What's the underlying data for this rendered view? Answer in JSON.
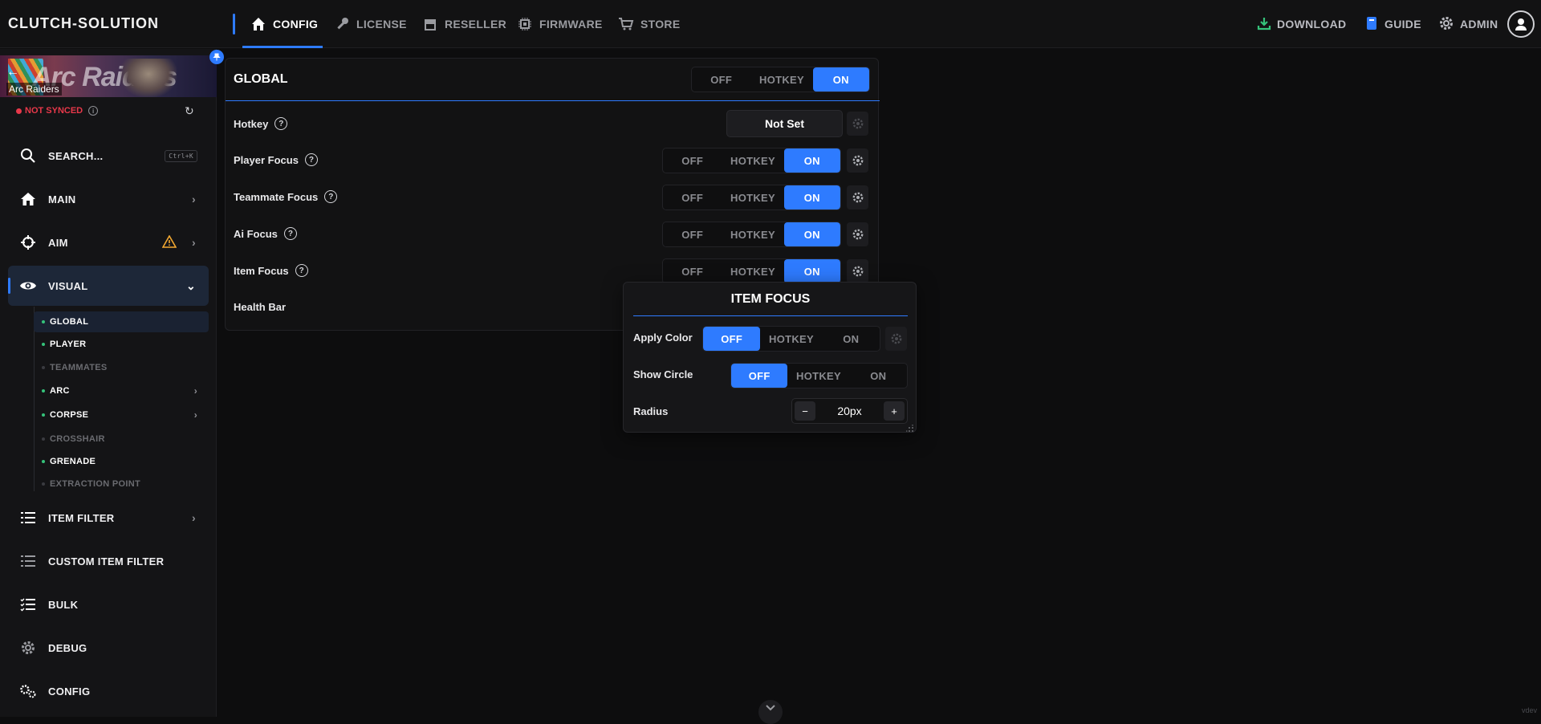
{
  "app": {
    "brand": "CLUTCH-SOLUTION",
    "accent": "#2e7bff",
    "version_tag": "vdev"
  },
  "nav": {
    "tabs": [
      {
        "label": "CONFIG",
        "icon": "home-icon",
        "active": true
      },
      {
        "label": "LICENSE",
        "icon": "key-icon"
      },
      {
        "label": "RESELLER",
        "icon": "store-icon"
      },
      {
        "label": "FIRMWARE",
        "icon": "chip-icon"
      },
      {
        "label": "STORE",
        "icon": "cart-icon"
      }
    ],
    "right": {
      "download": "DOWNLOAD",
      "guide": "GUIDE",
      "admin": "ADMIN"
    }
  },
  "sidebar": {
    "game_name": "Arc Raiders",
    "banner_text": "Arc Raiders",
    "sync_status": "NOT SYNCED",
    "search_label": "SEARCH...",
    "search_shortcut": "Ctrl+K",
    "items": [
      {
        "label": "MAIN",
        "icon": "home-icon"
      },
      {
        "label": "AIM",
        "icon": "crosshair-icon",
        "warning": true
      },
      {
        "label": "VISUAL",
        "icon": "eye-icon",
        "active": true
      },
      {
        "label": "ITEM FILTER",
        "icon": "list-icon"
      },
      {
        "label": "CUSTOM ITEM FILTER",
        "icon": "list-icon"
      },
      {
        "label": "BULK",
        "icon": "checklist-icon"
      },
      {
        "label": "DEBUG",
        "icon": "gear-icon"
      },
      {
        "label": "CONFIG",
        "icon": "gears-icon"
      }
    ],
    "visual_sub": [
      {
        "label": "GLOBAL",
        "enabled": true,
        "selected": true
      },
      {
        "label": "PLAYER",
        "enabled": true
      },
      {
        "label": "TEAMMATES",
        "enabled": false
      },
      {
        "label": "ARC",
        "enabled": true,
        "has_children": true
      },
      {
        "label": "CORPSE",
        "enabled": true,
        "has_children": true
      },
      {
        "label": "CROSSHAIR",
        "enabled": false
      },
      {
        "label": "GRENADE",
        "enabled": true
      },
      {
        "label": "EXTRACTION POINT",
        "enabled": false
      }
    ]
  },
  "panel": {
    "title": "GLOBAL",
    "toggle": {
      "off": "OFF",
      "hotkey": "HOTKEY",
      "on": "ON",
      "value": "ON"
    },
    "hotkey": {
      "label": "Hotkey",
      "value": "Not Set"
    },
    "rows": [
      {
        "label": "Player Focus",
        "value": "ON"
      },
      {
        "label": "Teammate Focus",
        "value": "ON"
      },
      {
        "label": "Ai Focus",
        "value": "ON"
      },
      {
        "label": "Item Focus",
        "value": "ON"
      },
      {
        "label": "Health Bar"
      }
    ]
  },
  "popup": {
    "title": "ITEM FOCUS",
    "apply_color": {
      "label": "Apply Color",
      "value": "OFF"
    },
    "show_circle": {
      "label": "Show Circle",
      "value": "OFF"
    },
    "radius": {
      "label": "Radius",
      "value": "20px",
      "minus": "−",
      "plus": "+"
    }
  }
}
